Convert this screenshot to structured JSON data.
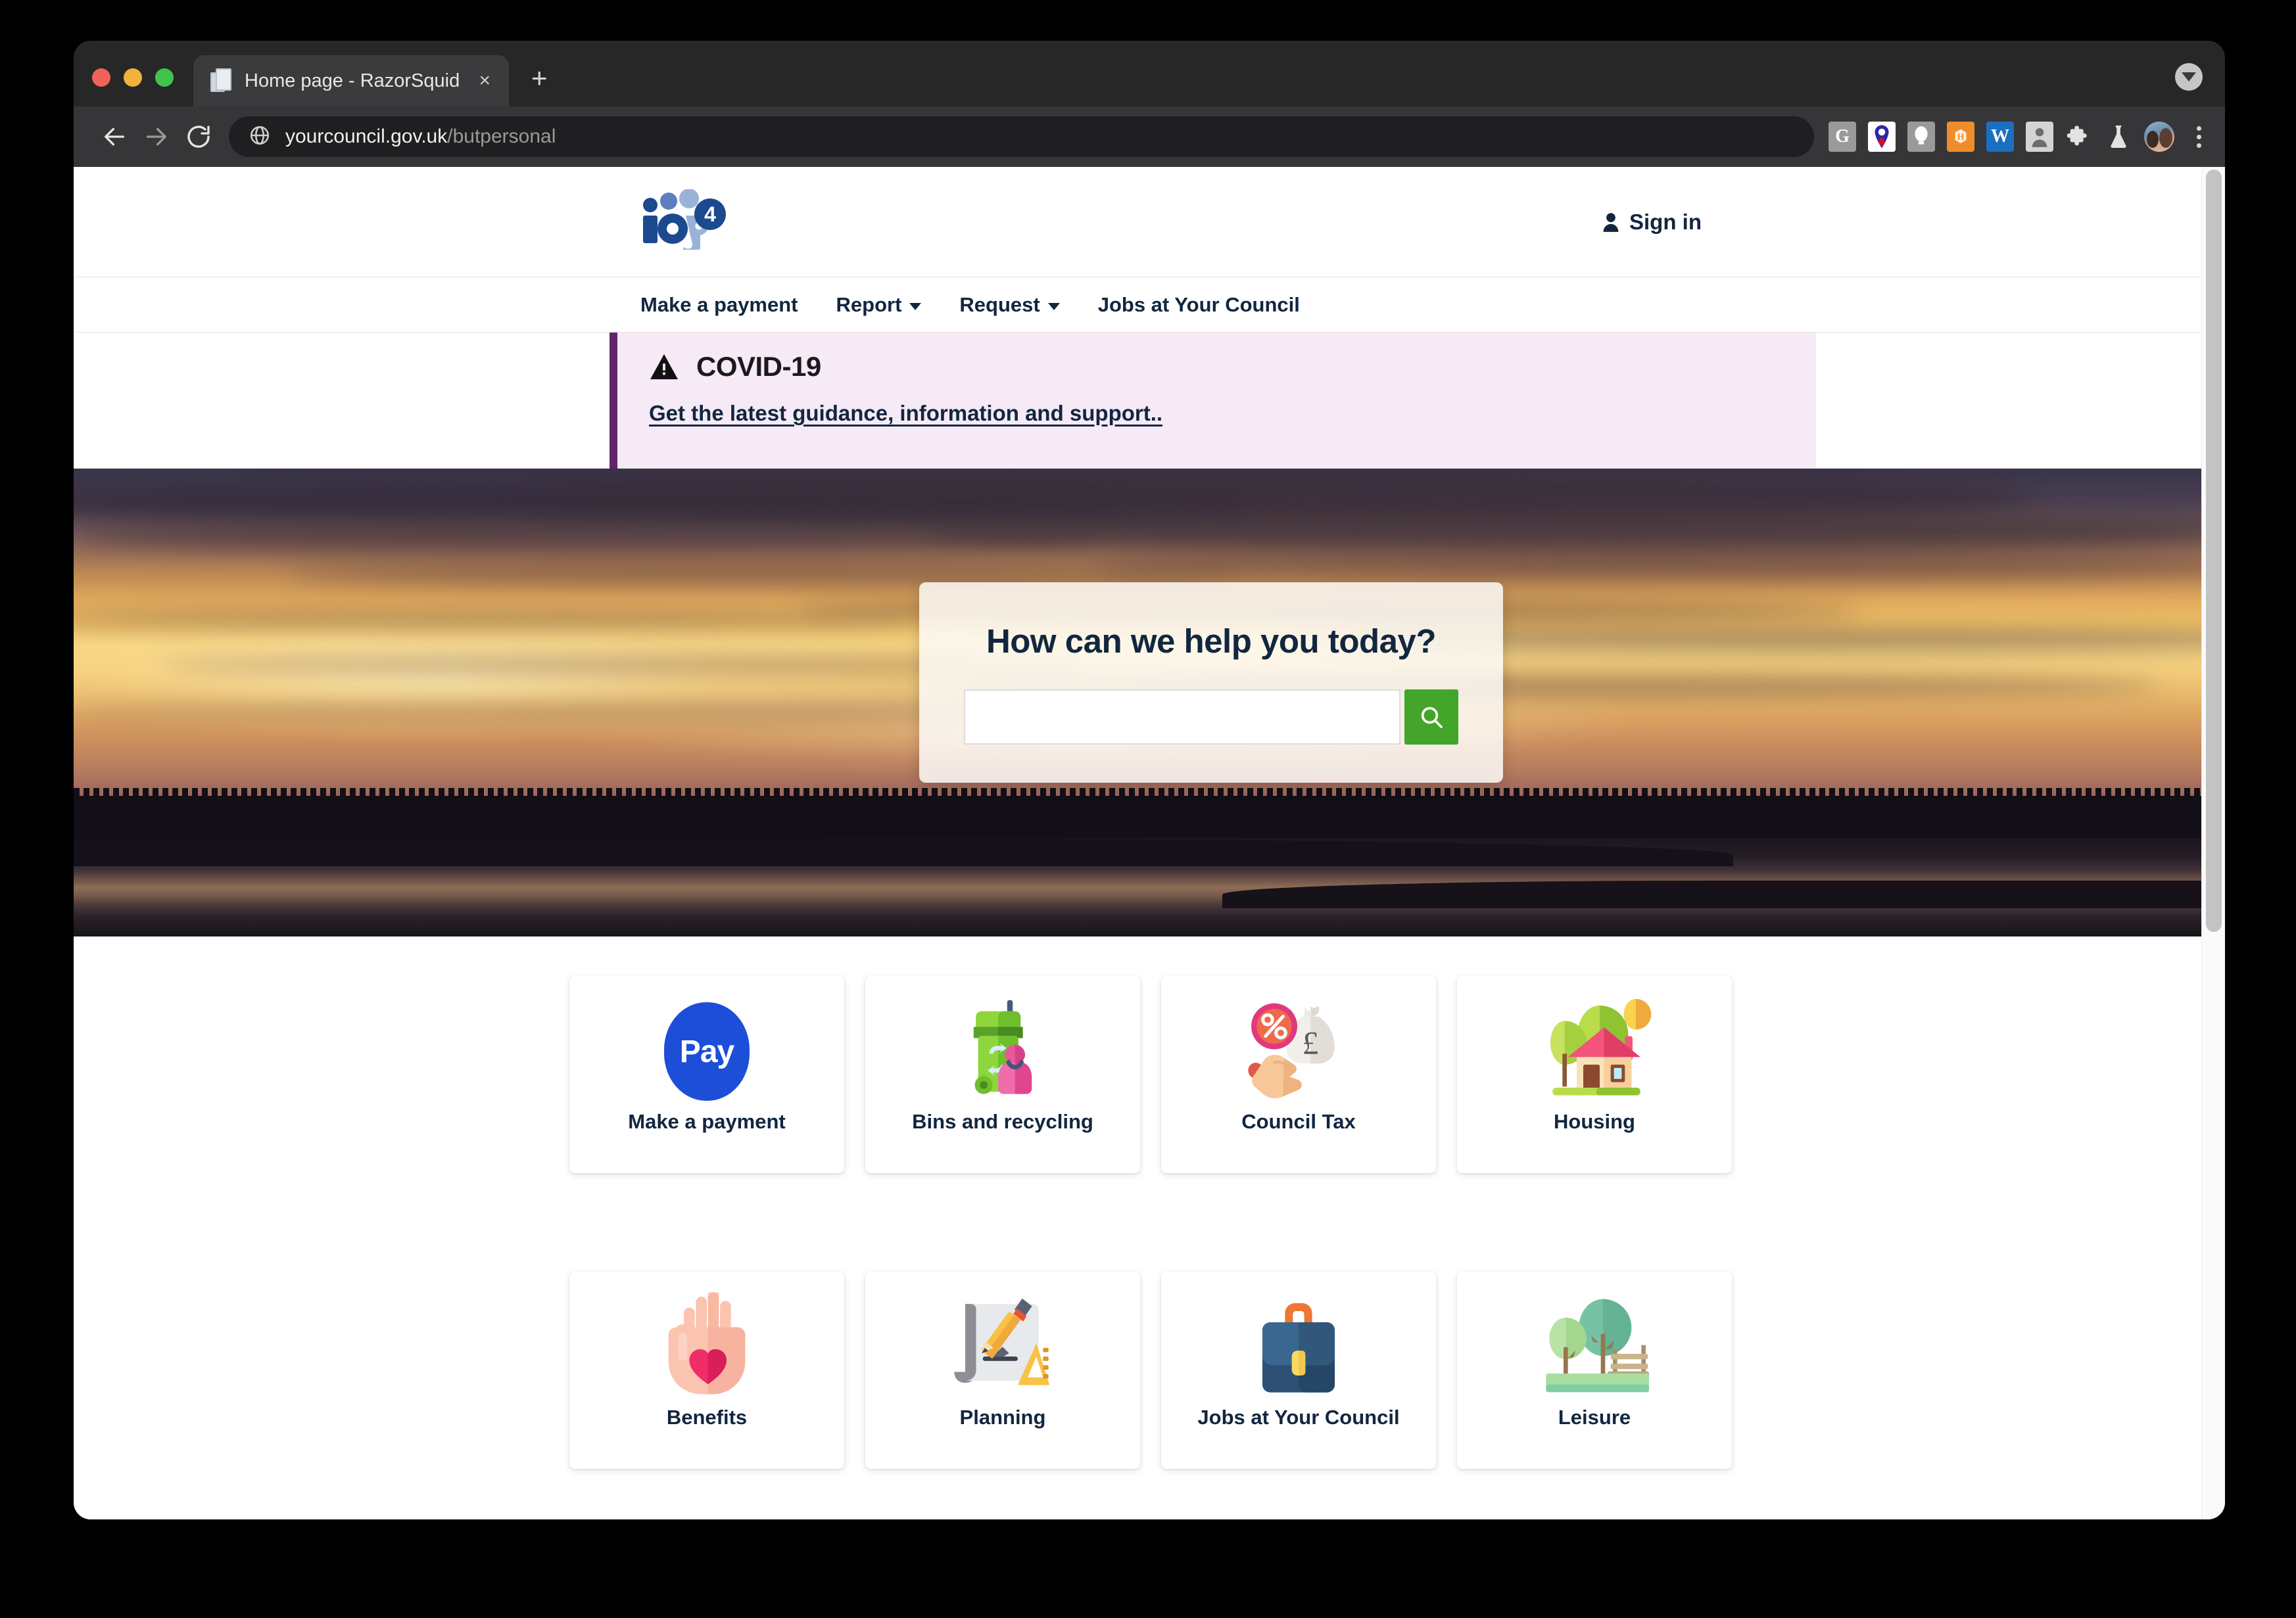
{
  "browser": {
    "tab_title": "Home page - RazorSquid",
    "tab_favicon_icon": "document-icon",
    "close_tab_label": "×",
    "new_tab_label": "+",
    "back_icon": "back-arrow-icon",
    "forward_icon": "forward-arrow-icon",
    "reload_icon": "reload-icon",
    "url_domain": "yourcouncil.gov.uk",
    "url_path": "/butpersonal",
    "site_info_icon": "globe-icon",
    "extensions": [
      {
        "name": "grammarly-extension-icon",
        "label": "G"
      },
      {
        "name": "location-pin-extension-icon",
        "label": ""
      },
      {
        "name": "lightbulb-extension-icon",
        "label": ""
      },
      {
        "name": "honey-extension-icon",
        "label": ""
      },
      {
        "name": "wikipedia-extension-icon",
        "label": "W"
      },
      {
        "name": "contact-extension-icon",
        "label": ""
      },
      {
        "name": "puzzle-extensions-icon",
        "label": ""
      },
      {
        "name": "flask-labs-icon",
        "label": ""
      }
    ],
    "avatar_icon": "profile-avatar",
    "menu_icon": "kebab-menu-icon",
    "cast_icon": "download-indicator-icon"
  },
  "site": {
    "logo": {
      "name": "ieg4-logo",
      "text": "ieg",
      "badge": "4",
      "colors": {
        "dark": "#1b4a8f",
        "mid": "#5b7fbf",
        "light": "#9bb2d8",
        "badge_bg": "#1b4a8f"
      }
    },
    "signin": {
      "label": "Sign in",
      "icon": "person-icon"
    },
    "nav": [
      {
        "label": "Make a payment",
        "has_dropdown": false
      },
      {
        "label": "Report",
        "has_dropdown": true
      },
      {
        "label": "Request",
        "has_dropdown": true
      },
      {
        "label": "Jobs at Your Council",
        "has_dropdown": false
      }
    ],
    "banner": {
      "icon": "warning-triangle-icon",
      "title": "COVID-19",
      "link_text": "Get the latest guidance, information and support..",
      "accent_color": "#62246b",
      "background_color": "#f5eaf6"
    },
    "hero": {
      "search_title": "How can we help you today?",
      "search_placeholder": "",
      "search_value": "",
      "search_button_icon": "search-icon",
      "search_button_color": "#43a62a"
    },
    "tiles": [
      {
        "label": "Make a payment",
        "icon": "pay-icon"
      },
      {
        "label": "Bins and recycling",
        "icon": "recycling-bin-icon"
      },
      {
        "label": "Council Tax",
        "icon": "money-bag-hand-icon"
      },
      {
        "label": "Housing",
        "icon": "house-icon"
      },
      {
        "label": "Benefits",
        "icon": "hand-heart-icon"
      },
      {
        "label": "Planning",
        "icon": "blueprint-pencil-icon"
      },
      {
        "label": "Jobs at Your Council",
        "icon": "briefcase-icon"
      },
      {
        "label": "Leisure",
        "icon": "park-bench-icon"
      }
    ]
  }
}
